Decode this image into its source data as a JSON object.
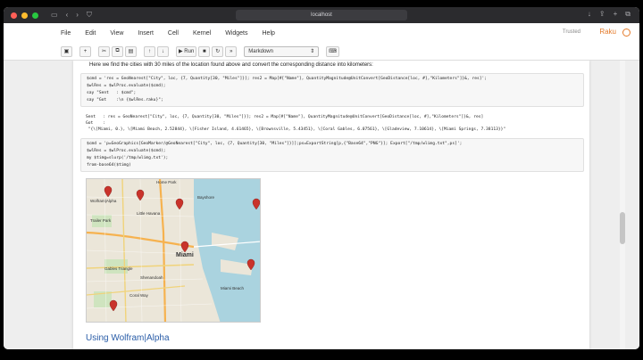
{
  "browser": {
    "address": "localhost"
  },
  "menubar": {
    "items": [
      "File",
      "Edit",
      "View",
      "Insert",
      "Cell",
      "Kernel",
      "Widgets",
      "Help"
    ],
    "trusted": "Trusted",
    "kernel": "Raku"
  },
  "toolbar": {
    "run_label": "Run",
    "cell_type": "Markdown"
  },
  "notebook": {
    "markdown_line": "Here we find the cities with 30 miles of the location found above and convert the corresponding distance into kilometers:",
    "cell1": {
      "lines": [
        "$cmd = 'res = GeoNearest[\"City\", loc, {7, Quantity[30, \"Miles\"]}]; res2 = Map[#[\"Name\"], QuantityMagnitude@UnitConvert[GeoDistance[loc, #],\"Kilometers\"]}&, res]';",
        "$wlRes = $wlProc.evaluate($cmd);",
        "say \"Sent   : $cmd\";",
        "say \"Got    :\\n {$wlRes.raku}\";"
      ]
    },
    "output1": {
      "lines": [
        "Sent   : res = GeoNearest[\"City\", loc, {7, Quantity[30, \"Miles\"]}]; res2 = Map[#[\"Name\"], QuantityMagnitude@UnitConvert[GeoDistance[loc, #],\"Kilometers\"]}&, res]",
        "Got    :",
        " \"{\\[Miami, 0.}, \\[Miami Beach, 2.52844}, \\[Fisher Island, 4.61465}, \\[Brownsville, 5.43451}, \\[Coral Gables, 6.07561}, \\[Gladeview, 7.10614}, \\[Miami Springs, 7.38113}}\""
      ]
    },
    "cell2": {
      "lines": [
        "$cmd = 'p=GeoGraphics[GeoMarker/@GeoNearest[\"City\", loc, {7, Quantity[30, \"Miles\"]}]];ps=ExportString[p,{\"Base64\",\"PNG\"}]; Export[\"/tmp/wlimg.txt\",ps]';",
        "$wlRes = $wlProc.evaluate($cmd);",
        "my $timg=slurp('/tmp/wlimg.txt');",
        "from-base64($timg)"
      ]
    },
    "map": {
      "labels": [
        "Home Park",
        "Wolfram|Alpha",
        "Bayshore",
        "Little Havana",
        "Trailer Park",
        "Miami",
        "Gables Triangle",
        "Shenandoah",
        "Miami Beach",
        "Coral Way"
      ],
      "marker_color": "#c9332b"
    },
    "next_section": "Using Wolfram|Alpha"
  }
}
